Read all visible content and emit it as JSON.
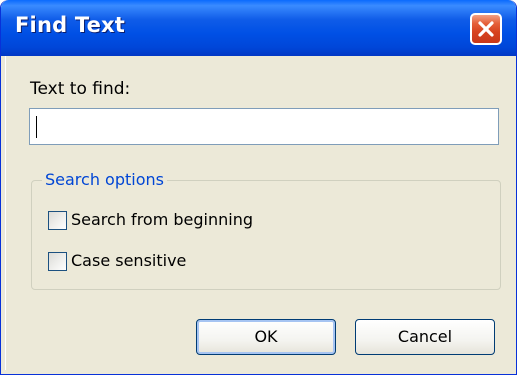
{
  "window": {
    "title": "Find Text"
  },
  "find": {
    "label": "Text to find:",
    "value": ""
  },
  "options": {
    "legend": "Search options",
    "search_from_beginning": {
      "label": "Search from beginning",
      "checked": false
    },
    "case_sensitive": {
      "label": "Case sensitive",
      "checked": false
    }
  },
  "buttons": {
    "ok": "OK",
    "cancel": "Cancel"
  },
  "icons": {
    "close": "close-icon"
  },
  "colors": {
    "titlebar": "#0050E5",
    "close_button": "#D7431F",
    "dialog_bg": "#ECE9D8",
    "legend_text": "#0046D5"
  }
}
